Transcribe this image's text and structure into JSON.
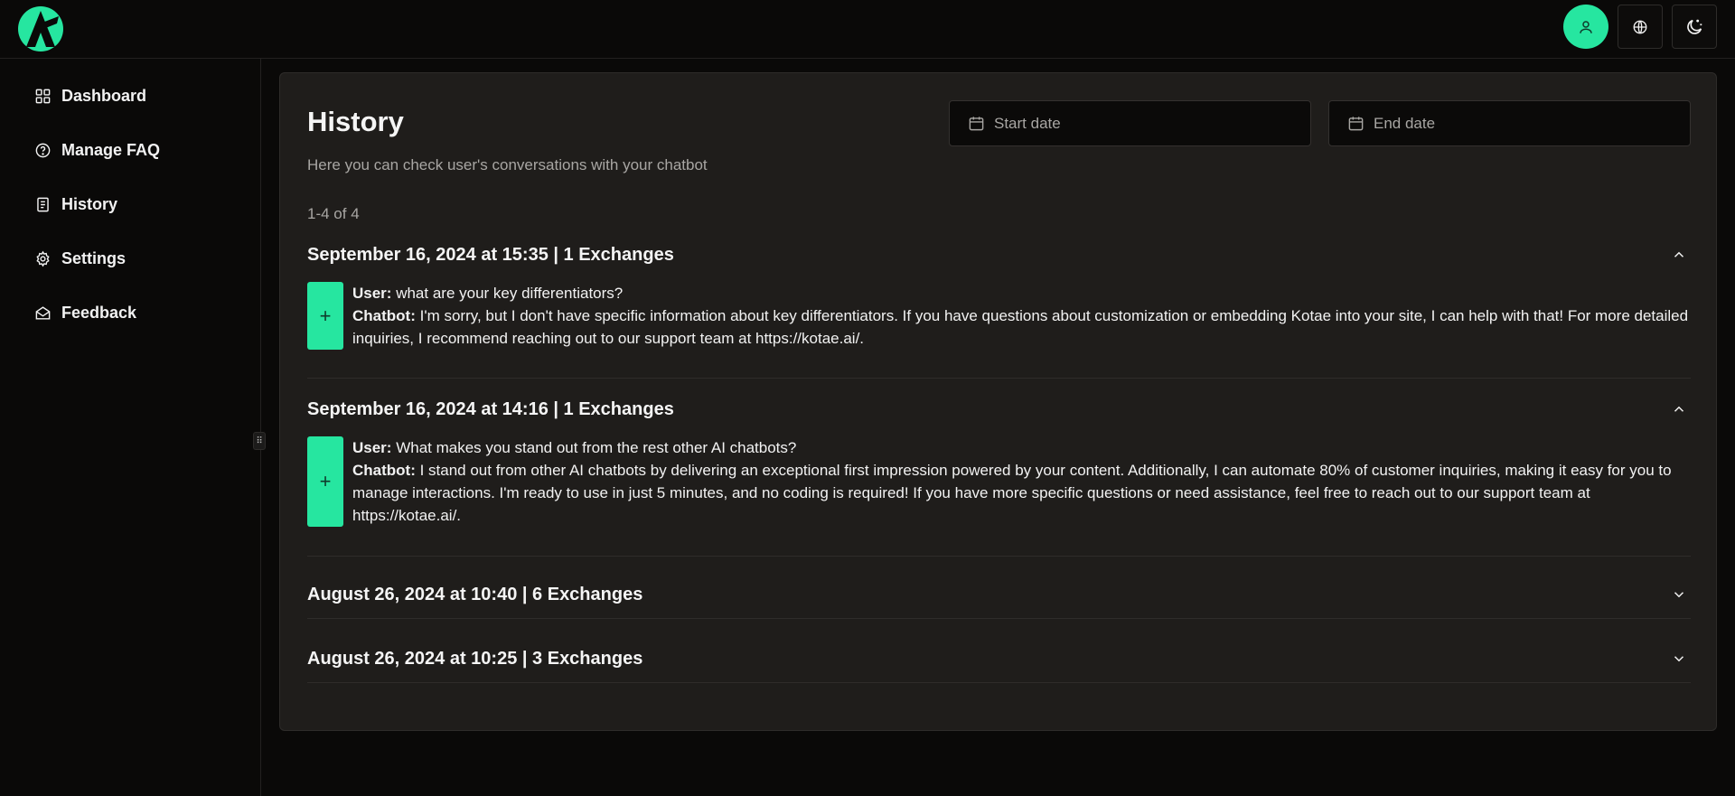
{
  "header": {
    "logo": "kotae-logo",
    "profile_icon": "user-icon",
    "language_icon": "globe-icon",
    "theme_icon": "moon-stars-icon",
    "accent_color": "#26e6a0"
  },
  "sidebar": {
    "items": [
      {
        "label": "Dashboard",
        "icon": "grid-icon"
      },
      {
        "label": "Manage FAQ",
        "icon": "help-circle-icon"
      },
      {
        "label": "History",
        "icon": "document-icon"
      },
      {
        "label": "Settings",
        "icon": "gear-icon"
      },
      {
        "label": "Feedback",
        "icon": "mail-open-icon"
      }
    ]
  },
  "main": {
    "title": "History",
    "subtitle": "Here you can check user's conversations with your chatbot",
    "start_date_placeholder": "Start date",
    "end_date_placeholder": "End date",
    "pagination": "1-4 of 4",
    "conversations": [
      {
        "title": "September 16, 2024 at 15:35 | 1 Exchanges",
        "expanded": true,
        "user_label": "User:",
        "user_text": " what are your key differentiators?",
        "bot_label": "Chatbot:",
        "bot_text": " I'm sorry, but I don't have specific information about key differentiators. If you have questions about customization or embedding Kotae into your site, I can help with that! For more detailed inquiries, I recommend reaching out to our support team at https://kotae.ai/."
      },
      {
        "title": "September 16, 2024 at 14:16 | 1 Exchanges",
        "expanded": true,
        "user_label": "User:",
        "user_text": " What makes you stand out from the rest other AI chatbots?",
        "bot_label": "Chatbot:",
        "bot_text": " I stand out from other AI chatbots by delivering an exceptional first impression powered by your content. Additionally, I can automate 80% of customer inquiries, making it easy for you to manage interactions. I'm ready to use in just 5 minutes, and no coding is required! If you have more specific questions or need assistance, feel free to reach out to our support team at https://kotae.ai/."
      },
      {
        "title": "August 26, 2024 at 10:40 | 6 Exchanges",
        "expanded": false
      },
      {
        "title": "August 26, 2024 at 10:25 | 3 Exchanges",
        "expanded": false
      }
    ],
    "expand_symbol": "+"
  }
}
